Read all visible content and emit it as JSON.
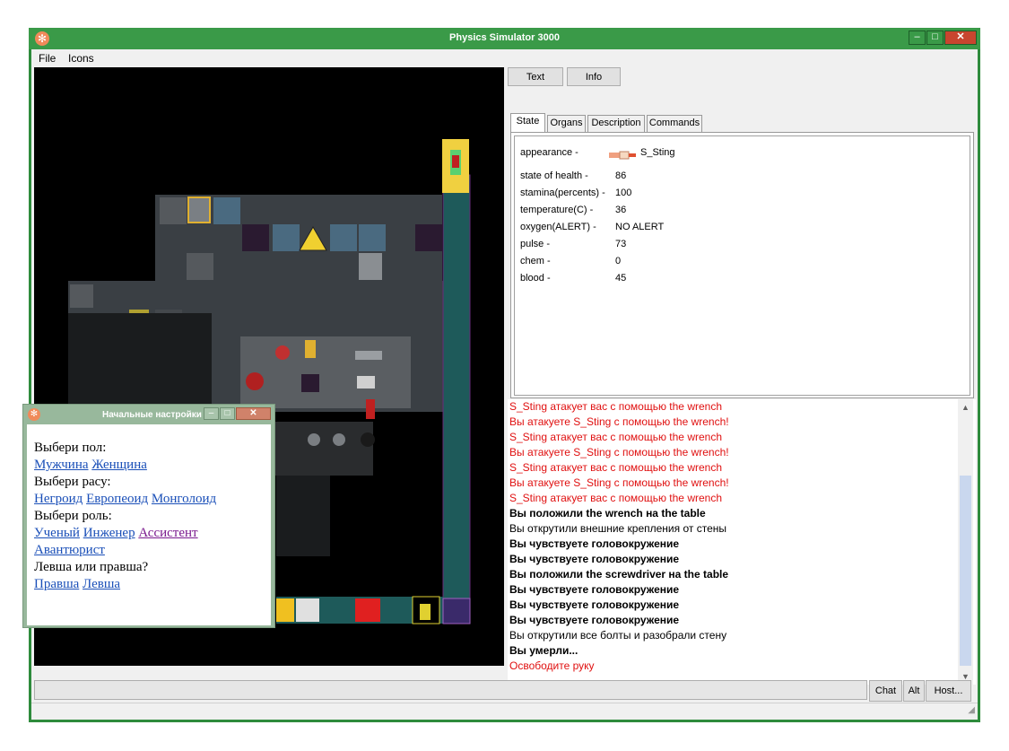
{
  "window": {
    "title": "Physics Simulator 3000",
    "icon": "snowflake-icon",
    "minimize_glyph": "–",
    "maximize_glyph": "□",
    "close_glyph": "✕"
  },
  "menu": {
    "file": "File",
    "icons": "Icons"
  },
  "right_panel": {
    "top_buttons": {
      "text": "Text",
      "info": "Info"
    },
    "tabs": [
      "State",
      "Organs",
      "Description",
      "Commands"
    ],
    "state": {
      "appearance_label": "appearance -",
      "appearance_value": "S_Sting",
      "rows": [
        {
          "label": "state of health -",
          "value": "86"
        },
        {
          "label": "stamina(percents) -",
          "value": "100"
        },
        {
          "label": "temperature(C) -",
          "value": "36"
        },
        {
          "label": "oxygen(ALERT) -",
          "value": "NO ALERT"
        },
        {
          "label": "pulse -",
          "value": "73"
        },
        {
          "label": "chem -",
          "value": "0"
        },
        {
          "label": "blood -",
          "value": "45"
        }
      ]
    },
    "log": [
      {
        "text": "S_Sting атакует вас с помощью the wrench",
        "style": "red"
      },
      {
        "text": "Вы атакуете S_Sting с помощью the wrench!",
        "style": "red"
      },
      {
        "text": "S_Sting атакует вас с помощью the wrench",
        "style": "red"
      },
      {
        "text": "Вы атакуете S_Sting с помощью the wrench!",
        "style": "red"
      },
      {
        "text": "S_Sting атакует вас с помощью the wrench",
        "style": "red"
      },
      {
        "text": "Вы атакуете S_Sting с помощью the wrench!",
        "style": "red"
      },
      {
        "text": "S_Sting атакует вас с помощью the wrench",
        "style": "red"
      },
      {
        "text": "Вы положили the wrench на the table",
        "style": "bold"
      },
      {
        "text": "Вы открутили внешние крепления от стены",
        "style": "plain"
      },
      {
        "text": "Вы чувствуете головокружение",
        "style": "bold"
      },
      {
        "text": "Вы чувствуете головокружение",
        "style": "bold"
      },
      {
        "text": "Вы положили the screwdriver на the table",
        "style": "bold"
      },
      {
        "text": "Вы чувствуете головокружение",
        "style": "bold"
      },
      {
        "text": "Вы чувствуете головокружение",
        "style": "bold"
      },
      {
        "text": "Вы чувствуете головокружение",
        "style": "bold"
      },
      {
        "text": "Вы открутили все болты и разобрали стену",
        "style": "plain"
      },
      {
        "text": "Вы умерли...",
        "style": "bold"
      },
      {
        "text": "Освободите руку",
        "style": "red"
      }
    ]
  },
  "bottom": {
    "input_value": "",
    "chat": "Chat",
    "alt": "Alt",
    "host": "Host..."
  },
  "dialog": {
    "title": "Начальные настройки",
    "gender_prompt": "Выбери пол:",
    "gender_options": [
      "Мужчина",
      "Женщина"
    ],
    "race_prompt": "Выбери расу:",
    "race_options": [
      "Негроид",
      "Европеоид",
      "Монголоид"
    ],
    "role_prompt": "Выбери роль:",
    "role_options": [
      "Ученый",
      "Инженер",
      "Ассистент",
      "Авантюрист"
    ],
    "hand_prompt": "Левша или правша?",
    "hand_options": [
      "Правша",
      "Левша"
    ]
  },
  "colors": {
    "frame": "#2e8b3c",
    "log_red": "#e01010",
    "link": "#1a4fb8",
    "link_visited": "#7a1a8e",
    "close": "#c8452f"
  }
}
